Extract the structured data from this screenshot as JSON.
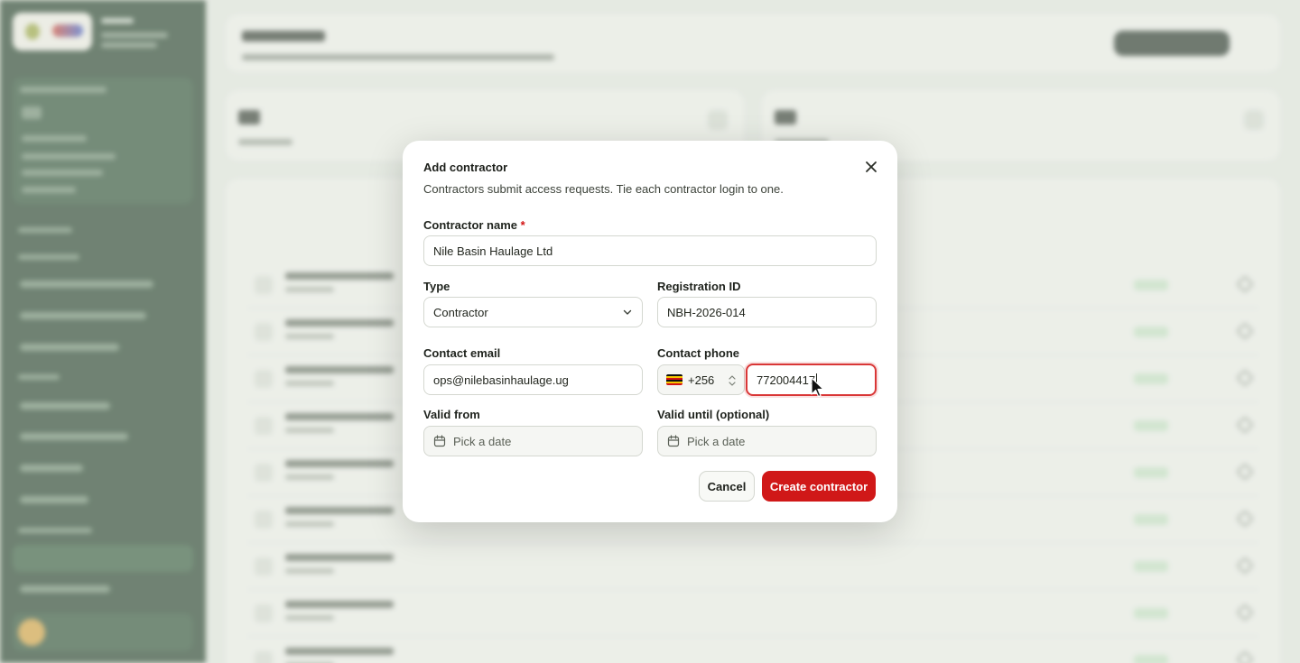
{
  "modal": {
    "title": "Add contractor",
    "description": "Contractors submit access requests. Tie each contractor login to one.",
    "contractor_name": {
      "label": "Contractor name",
      "required_mark": "*",
      "value": "Nile Basin Haulage Ltd"
    },
    "type": {
      "label": "Type",
      "value": "Contractor"
    },
    "registration_id": {
      "label": "Registration ID",
      "value": "NBH-2026-014"
    },
    "contact_email": {
      "label": "Contact email",
      "value": "ops@nilebasinhaulage.ug"
    },
    "contact_phone": {
      "label": "Contact phone",
      "country_code": "+256",
      "value": "772004417"
    },
    "valid_from": {
      "label": "Valid from",
      "placeholder": "Pick a date"
    },
    "valid_until": {
      "label": "Valid until (optional)",
      "placeholder": "Pick a date"
    },
    "cancel_label": "Cancel",
    "create_label": "Create contractor"
  },
  "colors": {
    "primary": "#d01818",
    "sidebar": "#1f3a26",
    "focus_border": "#d93636"
  },
  "icons": {
    "close": "close-icon",
    "chevron": "chevron-down-icon",
    "calendar": "calendar-icon",
    "flag": "uganda-flag-icon",
    "stepper": "up-down-chevron-icon"
  }
}
